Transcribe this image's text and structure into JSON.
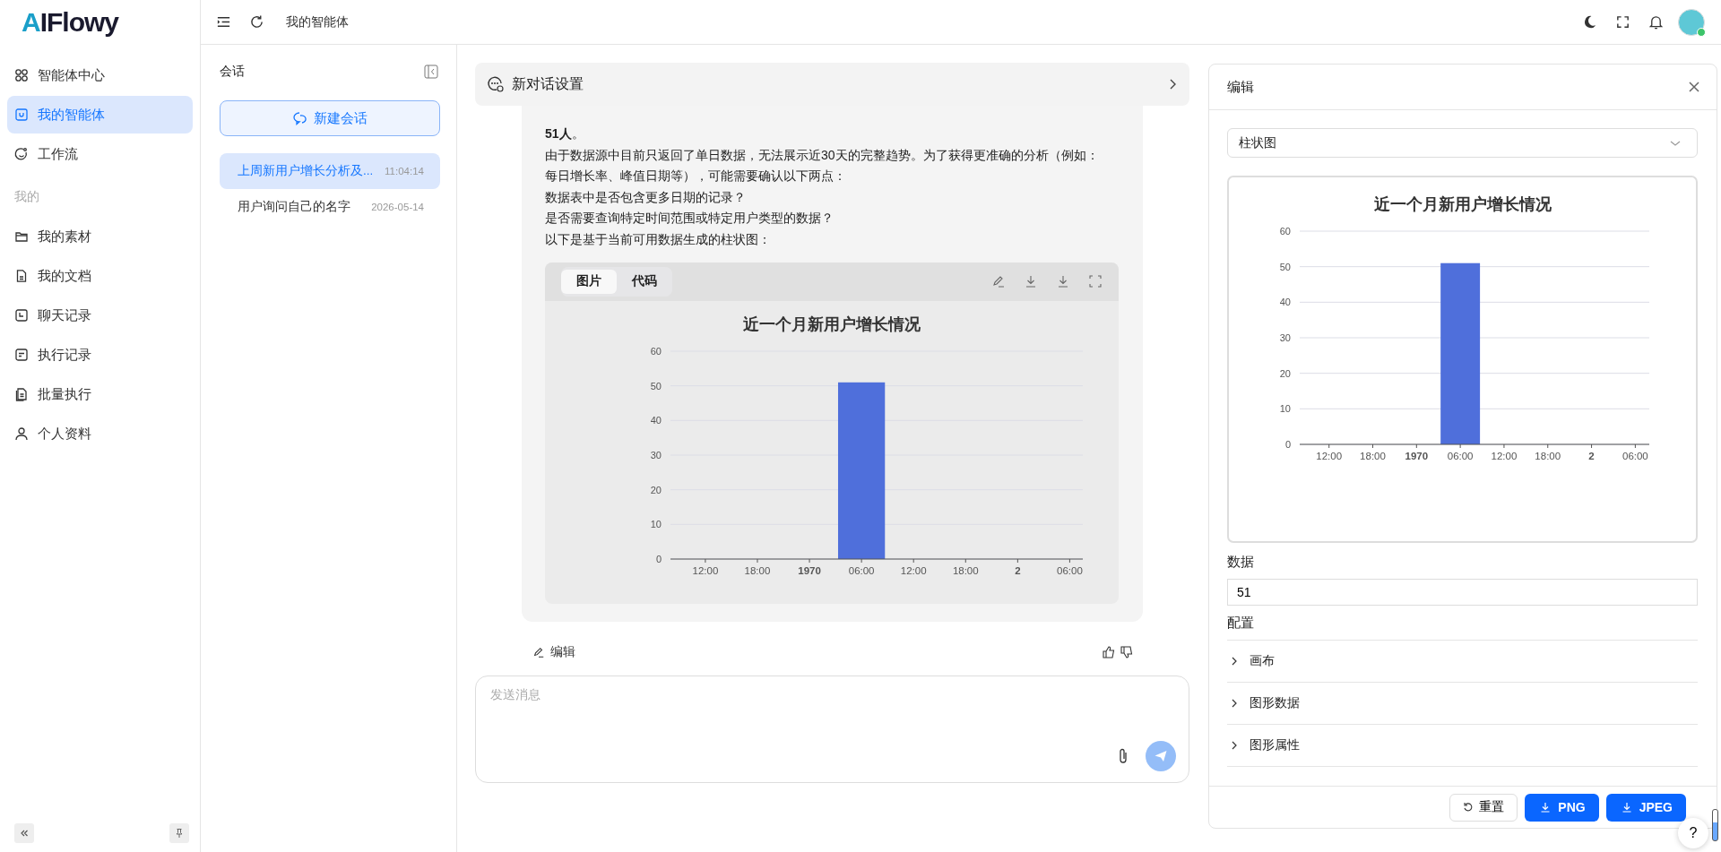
{
  "app": {
    "logo": "AIFlowy"
  },
  "sidebar": {
    "items": [
      {
        "label": "智能体中心",
        "selected": false
      },
      {
        "label": "我的智能体",
        "selected": true
      },
      {
        "label": "工作流",
        "selected": false
      }
    ],
    "section_label": "我的",
    "section_items": [
      {
        "label": "我的素材",
        "selected": false
      },
      {
        "label": "我的文档",
        "selected": false
      },
      {
        "label": "聊天记录",
        "selected": false
      },
      {
        "label": "执行记录",
        "selected": false
      },
      {
        "label": "批量执行",
        "selected": false
      },
      {
        "label": "个人资料",
        "selected": false
      }
    ]
  },
  "header": {
    "breadcrumb": "我的智能体"
  },
  "conversations": {
    "title": "会话",
    "new_button": "新建会话",
    "items": [
      {
        "title": "上周新用户增长分析及...",
        "time": "11:04:14",
        "selected": true
      },
      {
        "title": "用户询问自己的名字",
        "time": "2026-05-14",
        "selected": false
      }
    ]
  },
  "chat": {
    "settings_title": "新对话设置",
    "message": [
      "**51人**。",
      "由于数据源中目前只返回了单日数据，无法展示近30天的完整趋势。为了获得更准确的分析（例如：",
      "每日增长率、峰值日期等），可能需要确认以下两点：",
      "数据表中是否包含更多日期的记录？",
      "是否需要查询特定时间范围或特定用户类型的数据？",
      "以下是基于当前可用数据生成的柱状图："
    ],
    "chart_card": {
      "tabs": [
        {
          "label": "图片",
          "selected": true
        },
        {
          "label": "代码",
          "selected": false
        }
      ],
      "chart_data": {
        "type": "bar",
        "title": "近一个月新用户增长情况",
        "categories": [
          "12:00",
          "18:00",
          "**1970**",
          "06:00",
          "12:00",
          "18:00",
          "**2**",
          "06:00"
        ],
        "values": [
          null,
          null,
          null,
          51,
          null,
          null,
          null,
          null
        ],
        "ylim": [
          0,
          60
        ],
        "yticks": [
          0,
          10,
          20,
          30,
          40,
          50,
          60
        ],
        "grid": true
      }
    },
    "edit_label": "编辑",
    "input": {
      "placeholder": "发送消息"
    }
  },
  "editor": {
    "title": "编辑",
    "chart_type": "柱状图",
    "chart_data": {
      "type": "bar",
      "title": "近一个月新用户增长情况",
      "categories": [
        "12:00",
        "18:00",
        "**1970**",
        "06:00",
        "12:00",
        "18:00",
        "**2**",
        "06:00"
      ],
      "values": [
        null,
        null,
        null,
        51,
        null,
        null,
        null,
        null
      ],
      "ylim": [
        0,
        60
      ],
      "yticks": [
        0,
        10,
        20,
        30,
        40,
        50,
        60
      ],
      "grid": true
    },
    "data_label": "数据",
    "data_value": "51",
    "config_label": "配置",
    "sections": [
      {
        "label": "画布",
        "expanded": false
      },
      {
        "label": "图形数据",
        "expanded": false
      },
      {
        "label": "图形属性",
        "expanded": false
      }
    ],
    "reset_button": "重置",
    "png_button": "PNG",
    "jpeg_button": "JPEG"
  },
  "help": "?"
}
